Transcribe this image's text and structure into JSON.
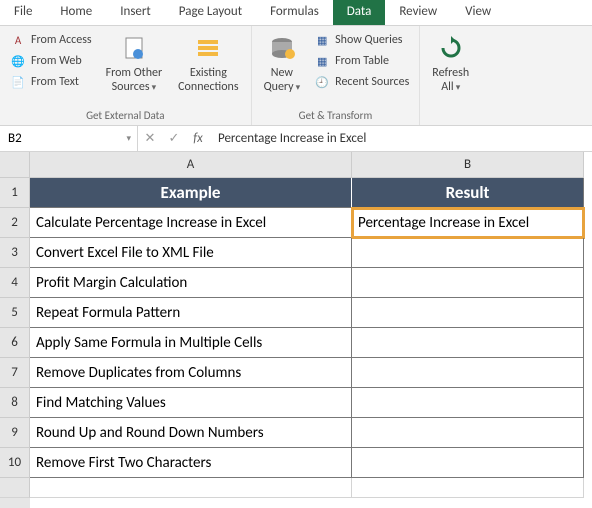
{
  "tabs": [
    "File",
    "Home",
    "Insert",
    "Page Layout",
    "Formulas",
    "Data",
    "Review",
    "View"
  ],
  "active_tab_index": 5,
  "ribbon": {
    "group1_label": "Get External Data",
    "from_access": "From Access",
    "from_web": "From Web",
    "from_text": "From Text",
    "from_other": "From Other\nSources",
    "existing": "Existing\nConnections",
    "group2_label": "Get & Transform",
    "new_query": "New\nQuery",
    "show_queries": "Show Queries",
    "from_table": "From Table",
    "recent_sources": "Recent Sources",
    "refresh_all": "Refresh\nAll"
  },
  "namebox": "B2",
  "formula_value": "Percentage Increase in Excel",
  "columns": [
    "A",
    "B"
  ],
  "header_row": [
    "Example",
    "Result"
  ],
  "rows": [
    [
      "Calculate Percentage Increase in Excel",
      "Percentage Increase in Excel"
    ],
    [
      "Convert Excel File to XML File",
      ""
    ],
    [
      "Profit Margin Calculation",
      ""
    ],
    [
      "Repeat Formula Pattern",
      ""
    ],
    [
      "Apply Same Formula in Multiple Cells",
      ""
    ],
    [
      "Remove Duplicates from Columns",
      ""
    ],
    [
      "Find Matching Values",
      ""
    ],
    [
      "Round Up and Round Down Numbers",
      ""
    ],
    [
      "Remove First Two Characters",
      ""
    ]
  ],
  "selected": {
    "row": 0,
    "col": 1
  }
}
